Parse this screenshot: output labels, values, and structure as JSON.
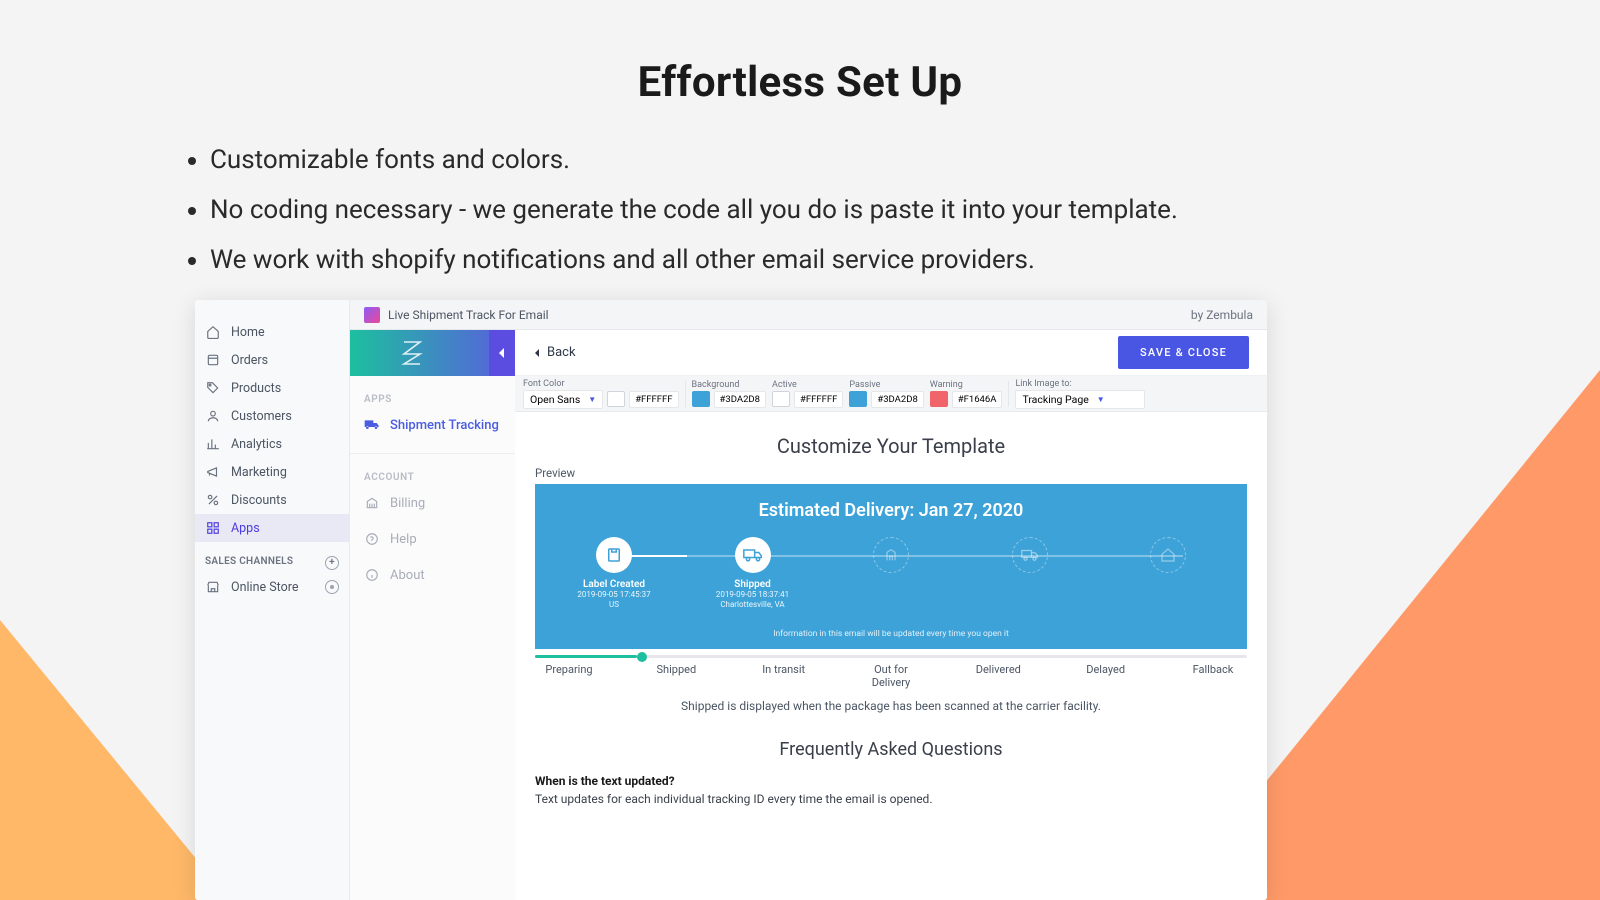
{
  "headline": "Effortless Set Up",
  "bullets": [
    "Customizable fonts and colors.",
    "No coding necessary - we generate the code all you do is paste it into your template.",
    "We work with shopify notifications and all other email service providers."
  ],
  "shopify_nav": {
    "items": [
      {
        "label": "Home"
      },
      {
        "label": "Orders"
      },
      {
        "label": "Products"
      },
      {
        "label": "Customers"
      },
      {
        "label": "Analytics"
      },
      {
        "label": "Marketing"
      },
      {
        "label": "Discounts"
      },
      {
        "label": "Apps"
      }
    ],
    "section_label": "SALES CHANNELS",
    "channels": [
      {
        "label": "Online Store"
      }
    ]
  },
  "topbar": {
    "title": "Live Shipment Track For Email",
    "by": "by Zembula"
  },
  "zside": {
    "apps_label": "APPS",
    "apps": [
      {
        "label": "Shipment Tracking"
      }
    ],
    "account_label": "ACCOUNT",
    "account": [
      {
        "label": "Billing"
      },
      {
        "label": "Help"
      },
      {
        "label": "About"
      }
    ]
  },
  "main": {
    "back": "Back",
    "save": "SAVE & CLOSE",
    "toolbar": {
      "font_label": "Font Color",
      "font_value": "Open Sans",
      "font_hex": "#FFFFFF",
      "bg_label": "Background",
      "bg_hex": "#3DA2D8",
      "active_label": "Active",
      "active_hex": "#FFFFFF",
      "passive_label": "Passive",
      "passive_hex": "#3DA2D8",
      "warn_label": "Warning",
      "warn_hex": "#F1646A",
      "link_label": "Link Image to:",
      "link_value": "Tracking Page"
    },
    "customize_title": "Customize Your Template",
    "preview_label": "Preview",
    "preview": {
      "title": "Estimated Delivery: Jan 27, 2020",
      "steps": [
        {
          "label": "Label Created",
          "line1": "2019-09-05 17:45:37",
          "line2": "US"
        },
        {
          "label": "Shipped",
          "line1": "2019-09-05 18:37:41",
          "line2": "Charlottesville, VA"
        }
      ],
      "footer": "Information in this email will be updated every time you open it"
    },
    "timeline": [
      "Preparing",
      "Shipped",
      "In transit",
      "Out for Delivery",
      "Delivered",
      "Delayed",
      "Fallback"
    ],
    "timeline_desc": "Shipped is displayed when the package has been scanned at the carrier facility.",
    "faq_title": "Frequently Asked Questions",
    "faq_q": "When is the text updated?",
    "faq_a": "Text updates for each individual tracking ID every time the email is opened."
  }
}
